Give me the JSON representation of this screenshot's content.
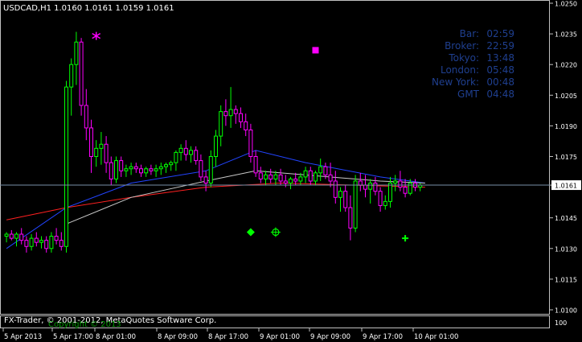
{
  "header": {
    "text": "USDCAD,H1  1.0160 1.0161 1.0159 1.0161"
  },
  "clock_panel": {
    "color": "#1f3f8f",
    "rows": [
      {
        "label": "Bar:",
        "value": "02:59"
      },
      {
        "label": "Broker:",
        "value": "22:59"
      },
      {
        "label": "Tokyo:",
        "value": "13:48"
      },
      {
        "label": "London:",
        "value": "05:48"
      },
      {
        "label": "New York:",
        "value": "00:48"
      },
      {
        "label": "GMT",
        "value": "04:48"
      }
    ]
  },
  "copyright": "FX-Trader, © 2001-2012, MetaQuotes Software Corp.",
  "footer_overlay": "Copyright © 2013",
  "colors": {
    "background": "#000000",
    "bull": "#00ff00",
    "bear": "#ff00ff",
    "grid": "#c0c0c0",
    "ma_blue": "#2244ff",
    "ma_red": "#ff2020",
    "ma_gray": "#c8c8c8",
    "current_price_line": "#7890a8"
  },
  "chart_data": {
    "type": "candlestick",
    "symbol": "USDCAD",
    "timeframe": "H1",
    "ylim": [
      1.01,
      1.025
    ],
    "price_ticks": [
      "1.0250",
      "1.0235",
      "1.0220",
      "1.0205",
      "1.0190",
      "1.0175",
      "1.0161",
      "1.0145",
      "1.0130",
      "1.0115",
      "1.0100"
    ],
    "current_price": "1.0161",
    "time_labels": [
      "5 Apr 2013",
      "5 Apr 17:00",
      "8 Apr 01:00",
      "8 Apr 09:00",
      "8 Apr 17:00",
      "9 Apr 01:00",
      "9 Apr 09:00",
      "9 Apr 17:00",
      "10 Apr 01:00"
    ],
    "ohlc": [
      [
        1.0136,
        1.0138,
        1.0133,
        1.0137
      ],
      [
        1.0137,
        1.0139,
        1.0134,
        1.0135
      ],
      [
        1.0135,
        1.0138,
        1.0131,
        1.0137
      ],
      [
        1.0137,
        1.014,
        1.0132,
        1.0134
      ],
      [
        1.0134,
        1.0136,
        1.0128,
        1.0131
      ],
      [
        1.0131,
        1.0137,
        1.0129,
        1.0135
      ],
      [
        1.0135,
        1.0138,
        1.0131,
        1.0133
      ],
      [
        1.0133,
        1.0136,
        1.013,
        1.0134
      ],
      [
        1.0134,
        1.0136,
        1.0128,
        1.013
      ],
      [
        1.013,
        1.0138,
        1.0128,
        1.0136
      ],
      [
        1.0136,
        1.014,
        1.0132,
        1.0134
      ],
      [
        1.0134,
        1.0138,
        1.0129,
        1.0131
      ],
      [
        1.0131,
        1.0212,
        1.0128,
        1.0209
      ],
      [
        1.0209,
        1.0223,
        1.0195,
        1.022
      ],
      [
        1.022,
        1.0236,
        1.021,
        1.0231
      ],
      [
        1.0231,
        1.0233,
        1.0195,
        1.02
      ],
      [
        1.02,
        1.0208,
        1.0183,
        1.0189
      ],
      [
        1.0189,
        1.0193,
        1.0167,
        1.0175
      ],
      [
        1.0175,
        1.0183,
        1.017,
        1.0179
      ],
      [
        1.0179,
        1.0187,
        1.0171,
        1.0181
      ],
      [
        1.0181,
        1.0185,
        1.0167,
        1.0172
      ],
      [
        1.0172,
        1.0175,
        1.0161,
        1.0164
      ],
      [
        1.0164,
        1.0175,
        1.0162,
        1.0173
      ],
      [
        1.0173,
        1.0175,
        1.0165,
        1.0168
      ],
      [
        1.0168,
        1.0171,
        1.0165,
        1.0169
      ],
      [
        1.0169,
        1.0172,
        1.0166,
        1.017
      ],
      [
        1.017,
        1.0172,
        1.0167,
        1.0169
      ],
      [
        1.0169,
        1.0171,
        1.0165,
        1.0167
      ],
      [
        1.0167,
        1.017,
        1.0165,
        1.0169
      ],
      [
        1.0169,
        1.0171,
        1.0166,
        1.0168
      ],
      [
        1.0168,
        1.0171,
        1.0165,
        1.0169
      ],
      [
        1.0169,
        1.0172,
        1.0166,
        1.017
      ],
      [
        1.017,
        1.0172,
        1.0167,
        1.0171
      ],
      [
        1.0171,
        1.0173,
        1.0168,
        1.0172
      ],
      [
        1.0172,
        1.0178,
        1.0168,
        1.0177
      ],
      [
        1.0177,
        1.0181,
        1.0173,
        1.0179
      ],
      [
        1.0179,
        1.0183,
        1.0173,
        1.0176
      ],
      [
        1.0176,
        1.018,
        1.0172,
        1.0178
      ],
      [
        1.0178,
        1.018,
        1.0171,
        1.0173
      ],
      [
        1.0173,
        1.0176,
        1.0163,
        1.0165
      ],
      [
        1.0165,
        1.0168,
        1.0158,
        1.0162
      ],
      [
        1.0162,
        1.0178,
        1.016,
        1.0175
      ],
      [
        1.0175,
        1.0188,
        1.017,
        1.0185
      ],
      [
        1.0185,
        1.02,
        1.018,
        1.0197
      ],
      [
        1.0197,
        1.0203,
        1.019,
        1.0195
      ],
      [
        1.0195,
        1.0209,
        1.0189,
        1.0198
      ],
      [
        1.0198,
        1.02,
        1.0191,
        1.0196
      ],
      [
        1.0196,
        1.0199,
        1.0189,
        1.0192
      ],
      [
        1.0192,
        1.0196,
        1.0185,
        1.0188
      ],
      [
        1.0188,
        1.0191,
        1.0172,
        1.0175
      ],
      [
        1.0175,
        1.0178,
        1.0165,
        1.0167
      ],
      [
        1.0167,
        1.017,
        1.0162,
        1.0164
      ],
      [
        1.0164,
        1.0168,
        1.0161,
        1.0166
      ],
      [
        1.0166,
        1.0169,
        1.0162,
        1.0164
      ],
      [
        1.0164,
        1.0168,
        1.0161,
        1.0166
      ],
      [
        1.0166,
        1.0169,
        1.0161,
        1.0163
      ],
      [
        1.0163,
        1.0166,
        1.016,
        1.0162
      ],
      [
        1.0162,
        1.0165,
        1.0159,
        1.0164
      ],
      [
        1.0164,
        1.0167,
        1.0161,
        1.0163
      ],
      [
        1.0163,
        1.0167,
        1.0161,
        1.0165
      ],
      [
        1.0165,
        1.017,
        1.0162,
        1.0168
      ],
      [
        1.0168,
        1.017,
        1.0161,
        1.0163
      ],
      [
        1.0163,
        1.0168,
        1.0161,
        1.0167
      ],
      [
        1.0167,
        1.0174,
        1.0163,
        1.017
      ],
      [
        1.017,
        1.0172,
        1.0164,
        1.0166
      ],
      [
        1.0166,
        1.0172,
        1.016,
        1.0163
      ],
      [
        1.0163,
        1.0168,
        1.0152,
        1.0155
      ],
      [
        1.0155,
        1.016,
        1.0148,
        1.0158
      ],
      [
        1.0158,
        1.0161,
        1.0148,
        1.015
      ],
      [
        1.015,
        1.0156,
        1.0134,
        1.014
      ],
      [
        1.014,
        1.0166,
        1.0138,
        1.0163
      ],
      [
        1.0163,
        1.0167,
        1.0158,
        1.0161
      ],
      [
        1.0161,
        1.0166,
        1.0155,
        1.0159
      ],
      [
        1.0159,
        1.0164,
        1.0152,
        1.0162
      ],
      [
        1.0162,
        1.0165,
        1.0156,
        1.0158
      ],
      [
        1.0158,
        1.016,
        1.0148,
        1.0151
      ],
      [
        1.0151,
        1.0156,
        1.0149,
        1.0153
      ],
      [
        1.0153,
        1.0165,
        1.015,
        1.0162
      ],
      [
        1.0162,
        1.0166,
        1.0158,
        1.0163
      ],
      [
        1.0163,
        1.0168,
        1.0158,
        1.016
      ],
      [
        1.016,
        1.0164,
        1.0155,
        1.0157
      ],
      [
        1.0157,
        1.0164,
        1.0156,
        1.0162
      ],
      [
        1.0162,
        1.0164,
        1.0158,
        1.016
      ],
      [
        1.016,
        1.0162,
        1.0158,
        1.0161
      ]
    ],
    "indicators": [
      {
        "name": "blue",
        "color": "#2244ff",
        "values": [
          [
            0,
            1.013
          ],
          [
            12,
            1.015
          ],
          [
            25,
            1.0162
          ],
          [
            40,
            1.0168
          ],
          [
            50,
            1.0178
          ],
          [
            60,
            1.0172
          ],
          [
            75,
            1.0165
          ],
          [
            84,
            1.0162
          ]
        ]
      },
      {
        "name": "red",
        "color": "#ff2020",
        "values": [
          [
            0,
            1.0144
          ],
          [
            12,
            1.015
          ],
          [
            25,
            1.0155
          ],
          [
            40,
            1.016
          ],
          [
            55,
            1.0162
          ],
          [
            70,
            1.0161
          ],
          [
            84,
            1.016
          ]
        ]
      },
      {
        "name": "gray",
        "color": "#c8c8c8",
        "values": [
          [
            12,
            1.0142
          ],
          [
            25,
            1.0155
          ],
          [
            40,
            1.0163
          ],
          [
            50,
            1.0168
          ],
          [
            60,
            1.0166
          ],
          [
            75,
            1.0163
          ],
          [
            84,
            1.0162
          ]
        ]
      }
    ],
    "markers": [
      {
        "shape": "asterisk",
        "color": "#ff00ff",
        "bar": 18,
        "price": 1.0234
      },
      {
        "shape": "square",
        "color": "#ff00ff",
        "bar": 62,
        "price": 1.0227
      },
      {
        "shape": "diamond",
        "color": "#00ff00",
        "bar": 49,
        "price": 1.0138
      },
      {
        "shape": "target",
        "color": "#00ff00",
        "bar": 54,
        "price": 1.0138
      },
      {
        "shape": "plus",
        "color": "#00ff00",
        "bar": 80,
        "price": 1.0135
      }
    ]
  },
  "right_axis_bottom_label": "100"
}
